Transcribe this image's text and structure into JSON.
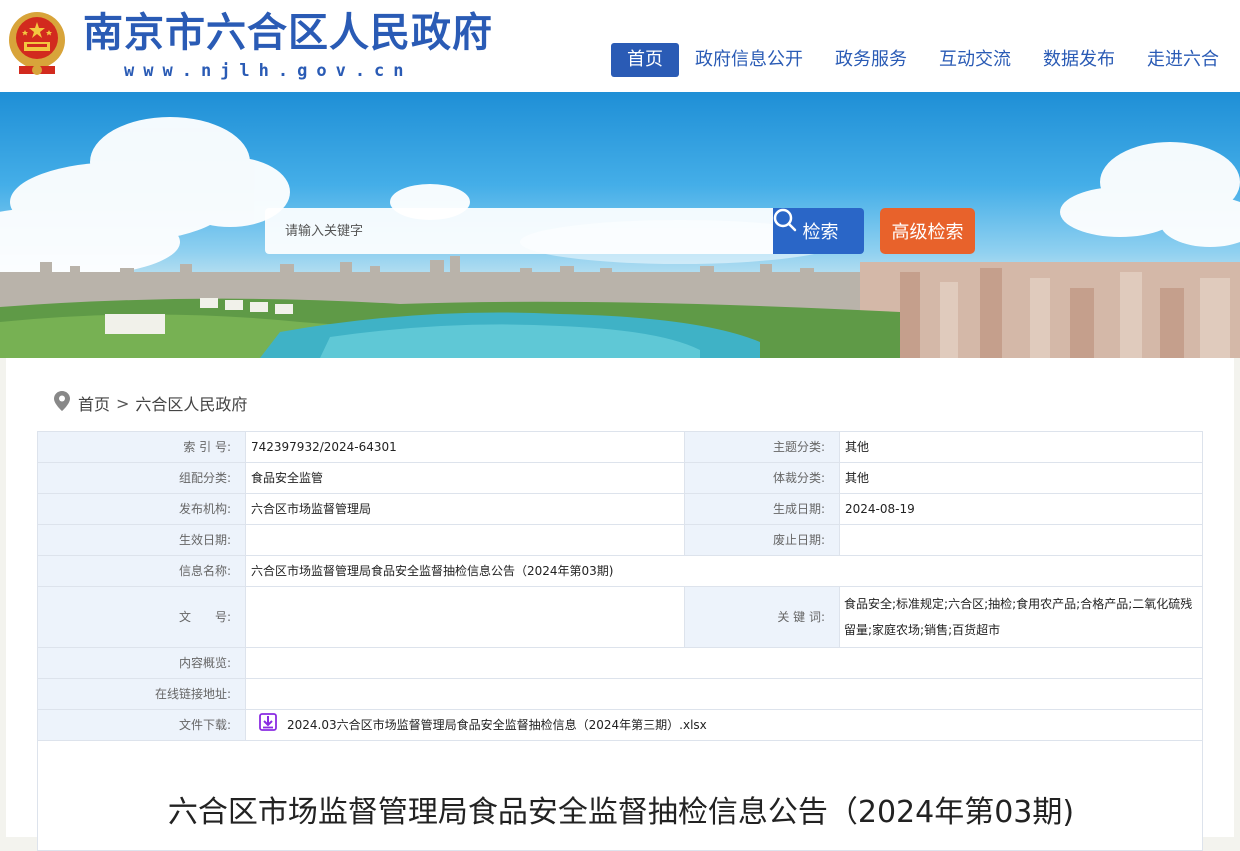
{
  "header": {
    "site_title": "南京市六合区人民政府",
    "site_domain": "www.njlh.gov.cn",
    "nav": [
      {
        "label": "首页",
        "active": true
      },
      {
        "label": "政府信息公开",
        "active": false
      },
      {
        "label": "政务服务",
        "active": false
      },
      {
        "label": "互动交流",
        "active": false
      },
      {
        "label": "数据发布",
        "active": false
      },
      {
        "label": "走进六合",
        "active": false
      }
    ]
  },
  "search": {
    "placeholder": "请输入关键字",
    "button_label": "检索",
    "advanced_label": "高级检索"
  },
  "breadcrumb": {
    "home": "首页",
    "separator": ">",
    "current": "六合区人民政府"
  },
  "meta": {
    "index_key": "索 引 号:",
    "index_value": "742397932/2024-64301",
    "topic_key": "主题分类:",
    "topic_value": "其他",
    "org_class_key": "组配分类:",
    "org_class_value": "食品安全监管",
    "genre_key": "体裁分类:",
    "genre_value": "其他",
    "publisher_key": "发布机构:",
    "publisher_value": "六合区市场监督管理局",
    "created_key": "生成日期:",
    "created_value": "2024-08-19",
    "effective_key": "生效日期:",
    "effective_value": "",
    "abolished_key": "废止日期:",
    "abolished_value": "",
    "name_key": "信息名称:",
    "name_value": "六合区市场监督管理局食品安全监督抽检信息公告（2024年第03期)",
    "docno_key": "文　　号:",
    "docno_value": "",
    "keywords_key": "关 键 词:",
    "keywords_value": "食品安全;标准规定;六合区;抽检;食用农产品;合格产品;二氧化硫残留量;家庭农场;销售;百货超市",
    "summary_key": "内容概览:",
    "summary_value": "",
    "link_key": "在线链接地址:",
    "link_value": "",
    "download_key": "文件下载:",
    "download_value": "2024.03六合区市场监督管理局食品安全监督抽检信息（2024年第三期）.xlsx"
  },
  "article": {
    "title": "六合区市场监督管理局食品安全监督抽检信息公告（2024年第03期)"
  },
  "colors": {
    "brand_blue": "#2a5bb5",
    "search_blue": "#2a66c7",
    "advanced_orange": "#e8622b",
    "table_key_bg": "#edf3fb",
    "download_icon": "#8a2be2"
  }
}
